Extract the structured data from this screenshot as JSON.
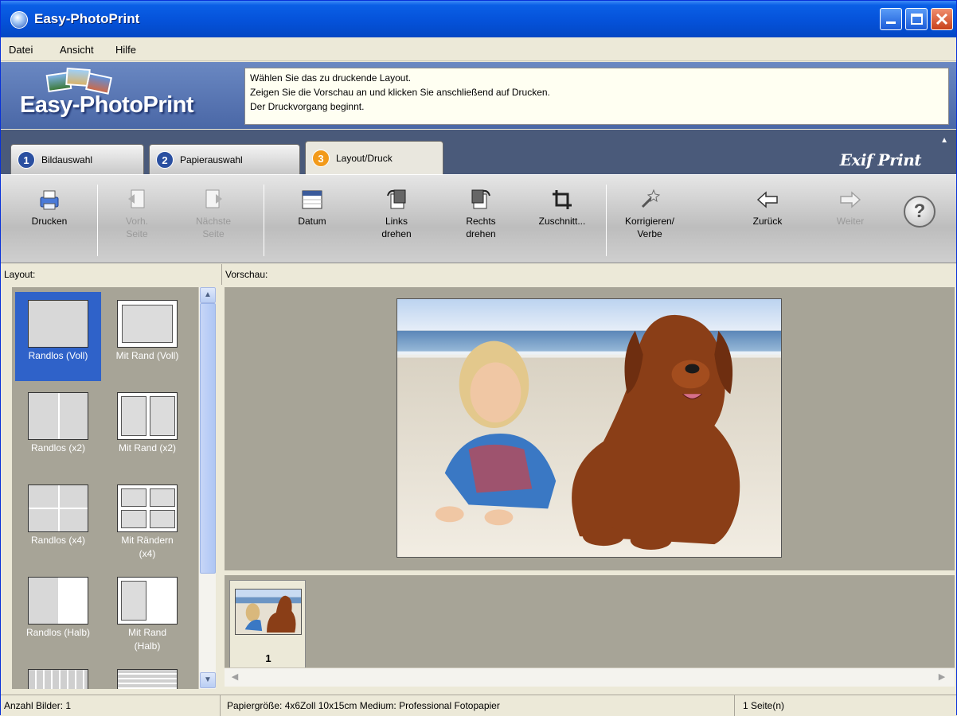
{
  "window": {
    "title": "Easy-PhotoPrint"
  },
  "menu": {
    "items": [
      "Datei",
      "Ansicht",
      "Hilfe"
    ]
  },
  "banner": {
    "logo_text": "Easy-PhotoPrint",
    "instructions": [
      "Wählen Sie das zu druckende Layout.",
      "Zeigen Sie die Vorschau an und klicken Sie anschließend auf Drucken.",
      "Der Druckvorgang beginnt."
    ]
  },
  "tabs": [
    {
      "number": "1",
      "label": "Bildauswahl"
    },
    {
      "number": "2",
      "label": "Papierauswahl"
    },
    {
      "number": "3",
      "label": "Layout/Druck",
      "active": true
    }
  ],
  "brand": {
    "exif_print": "Exif Print"
  },
  "toolbar": {
    "print": "Drucken",
    "prev_line1": "Vorh.",
    "prev_line2": "Seite",
    "next_line1": "Nächste",
    "next_line2": "Seite",
    "date": "Datum",
    "rotate_left_line1": "Links",
    "rotate_left_line2": "drehen",
    "rotate_right_line1": "Rechts",
    "rotate_right_line2": "drehen",
    "crop": "Zuschnitt...",
    "correct_line1": "Korrigieren/",
    "correct_line2": "Verbe",
    "back": "Zurück",
    "forward": "Weiter",
    "help_glyph": "?"
  },
  "panels": {
    "layout_label": "Layout:",
    "preview_label": "Vorschau:"
  },
  "layouts": [
    {
      "label": "Randlos (Voll)",
      "selected": true
    },
    {
      "label": "Mit Rand (Voll)"
    },
    {
      "label": "Randlos (x2)"
    },
    {
      "label": "Mit Rand (x2)"
    },
    {
      "label": "Randlos (x4)"
    },
    {
      "label_line1": "Mit Rändern",
      "label_line2": "(x4)"
    },
    {
      "label": "Randlos (Halb)"
    },
    {
      "label_line1": "Mit Rand",
      "label_line2": "(Halb)"
    }
  ],
  "thumbnail": {
    "page_number": "1"
  },
  "status": {
    "image_count": "Anzahl Bilder: 1",
    "paper": "Papiergröße: 4x6Zoll 10x15cm  Medium: Professional Fotopapier",
    "pages": "1 Seite(n)"
  },
  "colors": {
    "title_bar": "#0552d9",
    "tab_active_badge": "#f29a1a",
    "selection": "#2f62c9",
    "preview_bg": "#a7a497"
  }
}
